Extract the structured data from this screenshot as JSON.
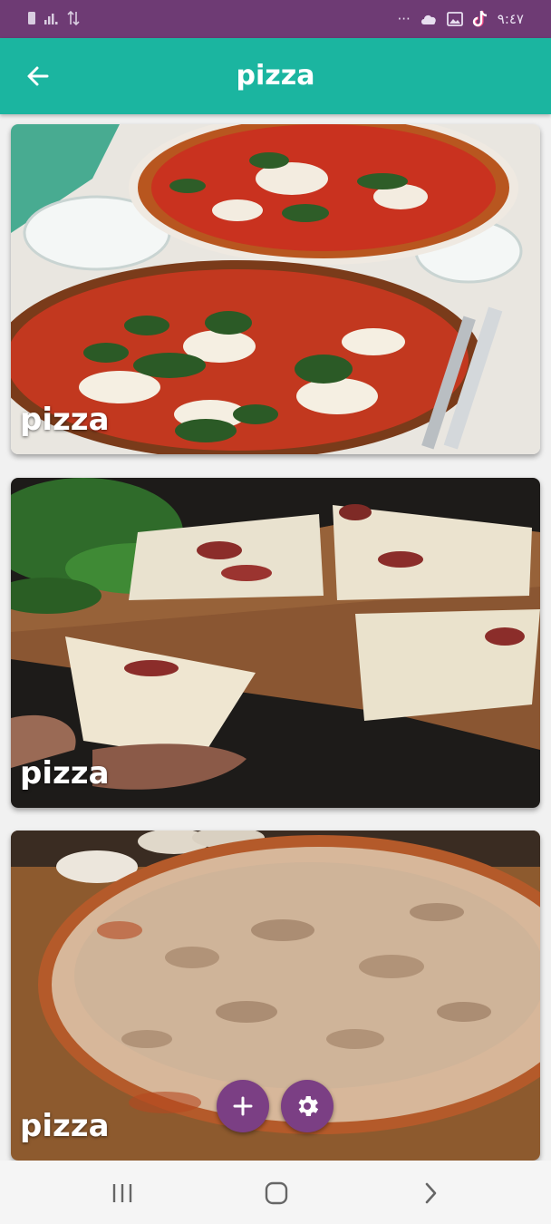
{
  "status_bar": {
    "time": "٩:٤٧",
    "overflow": "···",
    "icons": [
      "sim-icon",
      "signal-icon",
      "data-icon",
      "cloud-icon",
      "gallery-icon",
      "tiktok-icon"
    ]
  },
  "app_bar": {
    "title": "pizza",
    "back_icon": "arrow-left-icon"
  },
  "cards": [
    {
      "label": "pizza",
      "image": "pizza-margherita-photo"
    },
    {
      "label": "pizza",
      "image": "pizza-slices-board-photo"
    },
    {
      "label": "pizza",
      "image": "pizza-mushroom-photo"
    }
  ],
  "fabs": [
    {
      "icon": "plus-icon"
    },
    {
      "icon": "gear-icon"
    }
  ],
  "nav_bar": {
    "icons": [
      "recent-apps-icon",
      "home-icon",
      "back-chevron-icon"
    ]
  },
  "colors": {
    "status_bar": "#6e3b74",
    "app_bar": "#1bb5a0",
    "fab": "#7b3f84",
    "nav_bar": "#f5f5f5"
  }
}
